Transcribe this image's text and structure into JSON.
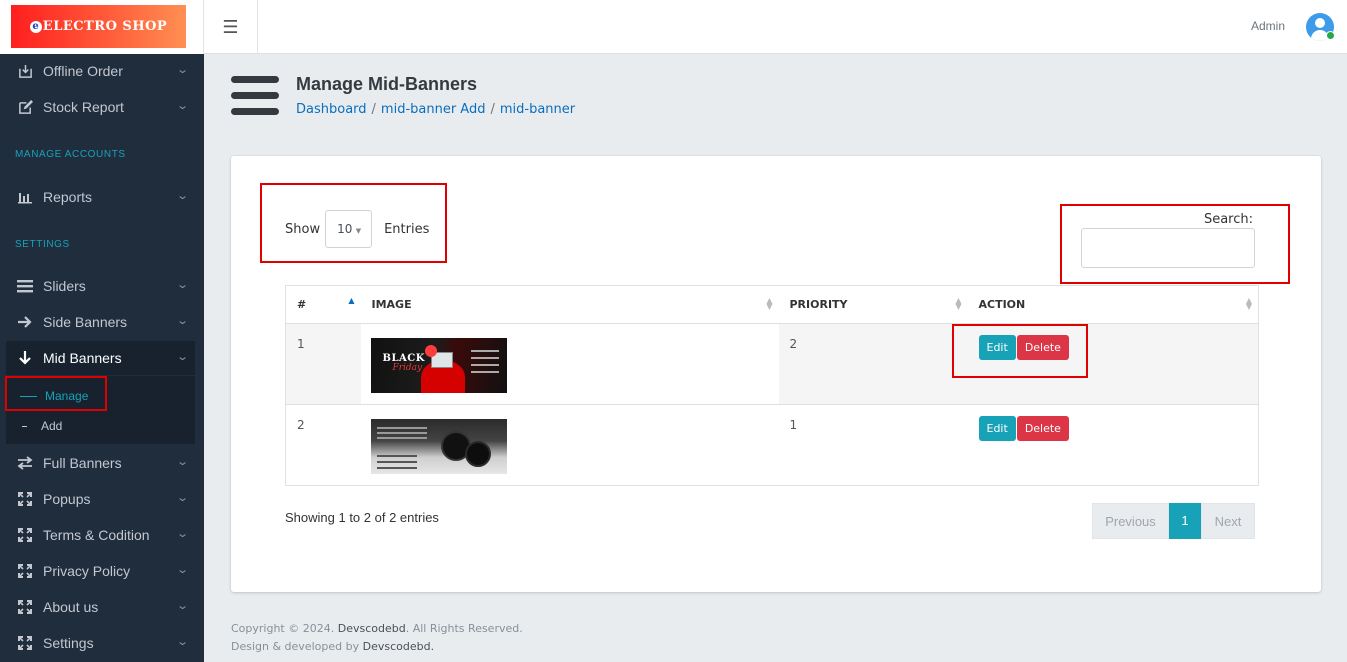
{
  "brand": {
    "logo_letter": "e",
    "logo_text": "ELECTRO SHOP"
  },
  "topbar": {
    "menu_icon": "hamburger-icon",
    "user_name": "Admin",
    "avatar_icon": "user-avatar-icon"
  },
  "sidebar": {
    "items": [
      {
        "label": "Offline Order",
        "icon": "download-box-icon"
      },
      {
        "label": "Stock Report",
        "icon": "edit-icon"
      },
      {
        "label": "Reports",
        "icon": "bar-chart-icon"
      },
      {
        "label": "Sliders",
        "icon": "bars-icon"
      },
      {
        "label": "Side Banners",
        "icon": "arrow-right-icon"
      },
      {
        "label": "Mid Banners",
        "icon": "arrow-down-icon"
      },
      {
        "label": "Full Banners",
        "icon": "exchange-icon"
      },
      {
        "label": "Popups",
        "icon": "expand-icon"
      },
      {
        "label": "Terms & Codition",
        "icon": "expand-icon"
      },
      {
        "label": "Privacy Policy",
        "icon": "expand-icon"
      },
      {
        "label": "About us",
        "icon": "expand-icon"
      },
      {
        "label": "Settings",
        "icon": "expand-icon"
      }
    ],
    "sections": {
      "accounts": "MANAGE ACCOUNTS",
      "settings": "SETTINGS"
    },
    "submenu": {
      "manage": "Manage",
      "add": "Add"
    }
  },
  "page": {
    "title": "Manage Mid-Banners",
    "breadcrumb": [
      "Dashboard",
      "mid-banner Add",
      "mid-banner"
    ]
  },
  "table_controls": {
    "show_label": "Show",
    "entries_value": "10",
    "entries_label": "Entries",
    "search_label": "Search:",
    "search_value": ""
  },
  "table": {
    "headers": [
      "#",
      "IMAGE",
      "PRIORITY",
      "ACTION"
    ],
    "rows": [
      {
        "num": "1",
        "priority": "2",
        "image": "black-friday-banner"
      },
      {
        "num": "2",
        "priority": "1",
        "image": "bose-earbuds-banner"
      }
    ],
    "edit_label": "Edit",
    "delete_label": "Delete"
  },
  "pagination": {
    "info": "Showing 1 to 2 of 2 entries",
    "previous": "Previous",
    "current": "1",
    "next": "Next"
  },
  "footer": {
    "copyright_prefix": "Copyright © 2024.",
    "company": "Devscodebd",
    "copyright_suffix": ". All Rights Reserved.",
    "designed_prefix": "Design & developed by",
    "designed_company": "Devscodebd."
  },
  "colors": {
    "sidebar_bg": "#1f2d3d",
    "accent": "#17a2b8",
    "danger": "#dc3545",
    "link": "#0a6ebd",
    "annotation": "#e00000"
  }
}
